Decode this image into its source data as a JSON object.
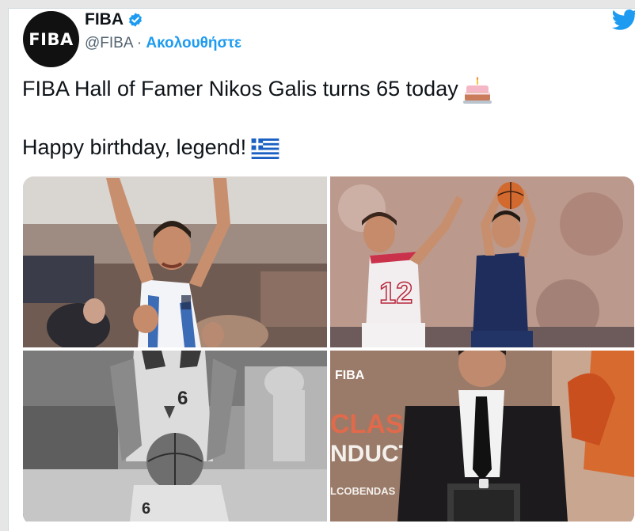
{
  "account": {
    "avatar_text": "FIBA",
    "display_name": "FIBA",
    "verified_icon": "verified-badge-icon",
    "handle": "@FIBA",
    "separator": "·",
    "follow_label": "Ακολουθήστε"
  },
  "brand_icon": "twitter-bird-icon",
  "tweet": {
    "line1": "FIBA Hall of Famer Nikos Galis turns 65 today",
    "line1_emoji": "birthday-cake-icon",
    "line2": "Happy birthday, legend!",
    "line2_emoji": "greek-flag-icon"
  },
  "media": {
    "photo_3_jersey": "6",
    "photo_2_jersey_left": "12",
    "photo_4_text": {
      "fiba": "FIBA",
      "class": "CLASS",
      "induct": "NDUCT",
      "alcobendas": "LCOBENDAS"
    }
  },
  "colors": {
    "accent": "#1d9bf0",
    "text": "#0f1419",
    "muted": "#536471"
  }
}
